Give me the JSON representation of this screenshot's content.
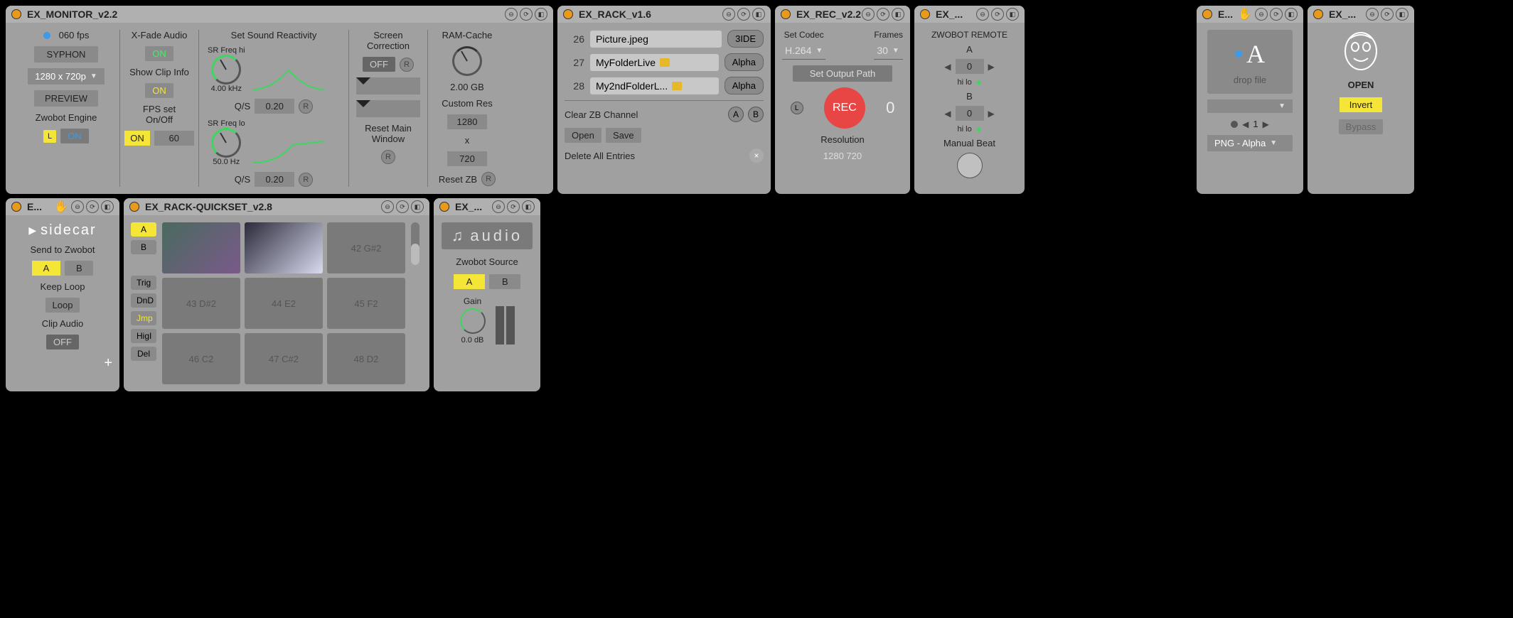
{
  "devices": {
    "monitor": {
      "title": "EX_MONITOR_v2.2",
      "fps": "060 fps",
      "syphon": "SYPHON",
      "res_select": "1280 x 720p",
      "preview": "PREVIEW",
      "engine_label": "Zwobot Engine",
      "engine_l": "L",
      "engine_on": "ON",
      "xfade_label": "X-Fade Audio",
      "xfade_on": "ON",
      "clipinfo_label": "Show Clip Info",
      "clipinfo_on": "ON",
      "fps_label": "FPS set On/Off",
      "fps_on": "ON",
      "fps_val": "60",
      "reactivity_title": "Set Sound Reactivity",
      "sr_hi_label": "SR Freq hi",
      "sr_hi_val": "4.00 kHz",
      "sr_lo_label": "SR Freq lo",
      "sr_lo_val": "50.0 Hz",
      "qs_label": "Q/S",
      "qs_val1": "0.20",
      "qs_val2": "0.20",
      "r": "R",
      "screen_corr": "Screen Correction",
      "off": "OFF",
      "reset_main": "Reset Main Window",
      "ram_cache": "RAM-Cache",
      "ram_val": "2.00 GB",
      "custom_res": "Custom Res",
      "cr_w": "1280",
      "cr_x": "x",
      "cr_h": "720",
      "reset_zb": "Reset ZB"
    },
    "rack": {
      "title": "EX_RACK_v1.6",
      "rows": [
        {
          "n": "26",
          "name": "Picture.jpeg",
          "btn": "3IDE"
        },
        {
          "n": "27",
          "name": "MyFolderLive",
          "btn": "Alpha"
        },
        {
          "n": "28",
          "name": "My2ndFolderL...",
          "btn": "Alpha"
        }
      ],
      "clear": "Clear ZB Channel",
      "a": "A",
      "b": "B",
      "open": "Open",
      "save": "Save",
      "delete_all": "Delete All Entries"
    },
    "rec": {
      "title": "EX_REC_v2.2",
      "codec_label": "Set Codec",
      "codec_val": "H.264",
      "frames_label": "Frames",
      "frames_val": "30",
      "set_output": "Set Output Path",
      "rec": "REC",
      "l": "L",
      "count": "0",
      "res_label": "Resolution",
      "res_val": "1280 720"
    },
    "remote": {
      "title": "EX_...",
      "header": "ZWOBOT REMOTE",
      "a": "A",
      "b": "B",
      "zero": "0",
      "hilo": "hi  lo",
      "manual": "Manual Beat"
    },
    "dropfile": {
      "title": "E...",
      "drop": "drop file",
      "page": "1",
      "format": "PNG - Alpha"
    },
    "mask": {
      "title": "EX_...",
      "open": "OPEN",
      "invert": "Invert",
      "bypass": "Bypass"
    },
    "sidecar": {
      "title": "E...",
      "logo": "sidecar",
      "send": "Send to Zwobot",
      "a": "A",
      "b": "B",
      "keep": "Keep Loop",
      "loop": "Loop",
      "clip_audio": "Clip Audio",
      "off": "OFF"
    },
    "quickset": {
      "title": "EX_RACK-QUICKSET_v2.8",
      "a": "A",
      "b": "B",
      "side": [
        "Trig",
        "DnD",
        "Jmp",
        "HigI",
        "Del"
      ],
      "cells": [
        "",
        "",
        "42 G#2",
        "43 D#2",
        "44 E2",
        "45 F2",
        "46 C2",
        "47 C#2",
        "48 D2"
      ]
    },
    "audio": {
      "title": "EX_...",
      "logo": "audio",
      "source": "Zwobot  Source",
      "a": "A",
      "b": "B",
      "gain": "Gain",
      "gain_val": "0.0 dB"
    }
  }
}
